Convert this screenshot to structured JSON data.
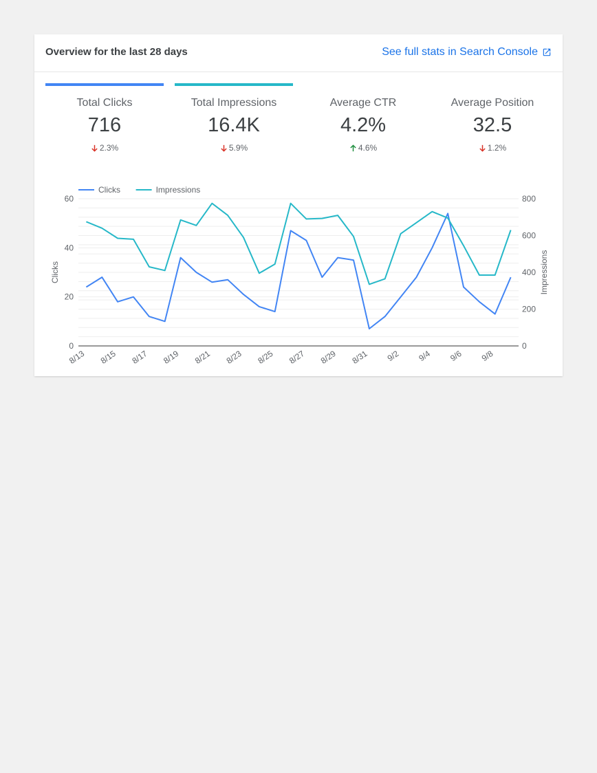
{
  "header": {
    "title": "Overview for the last 28 days",
    "link_label": "See full stats in Search Console"
  },
  "stats": [
    {
      "label": "Total Clicks",
      "value": "716",
      "change": "2.3%",
      "direction": "down",
      "bar_color": "#4285f4"
    },
    {
      "label": "Total Impressions",
      "value": "16.4K",
      "change": "5.9%",
      "direction": "down",
      "bar_color": "#26b8c8"
    },
    {
      "label": "Average CTR",
      "value": "4.2%",
      "change": "4.6%",
      "direction": "up",
      "bar_color": ""
    },
    {
      "label": "Average Position",
      "value": "32.5",
      "change": "1.2%",
      "direction": "down",
      "bar_color": ""
    }
  ],
  "colors": {
    "up": "#1e8e3e",
    "down": "#d93025",
    "link": "#1a73e8"
  },
  "chart_data": {
    "type": "line",
    "x": [
      "8/13",
      "8/14",
      "8/15",
      "8/16",
      "8/17",
      "8/18",
      "8/19",
      "8/20",
      "8/21",
      "8/22",
      "8/23",
      "8/24",
      "8/25",
      "8/26",
      "8/27",
      "8/28",
      "8/29",
      "8/30",
      "8/31",
      "9/1",
      "9/2",
      "9/3",
      "9/4",
      "9/5",
      "9/6",
      "9/7",
      "9/8",
      "9/9"
    ],
    "x_tick_labels": [
      "8/13",
      "8/15",
      "8/17",
      "8/19",
      "8/21",
      "8/23",
      "8/25",
      "8/27",
      "8/29",
      "8/31",
      "9/2",
      "9/4",
      "9/6",
      "9/8"
    ],
    "series": [
      {
        "name": "Clicks",
        "axis": "left",
        "color": "#4285f4",
        "values": [
          24,
          28,
          18,
          20,
          12,
          10,
          36,
          30,
          26,
          27,
          21,
          16,
          14,
          47,
          43,
          28,
          36,
          35,
          7,
          12,
          20,
          28,
          40,
          54,
          24,
          18,
          13,
          28
        ]
      },
      {
        "name": "Impressions",
        "axis": "right",
        "color": "#26b8c8",
        "values": [
          675,
          640,
          585,
          580,
          430,
          410,
          685,
          655,
          775,
          710,
          590,
          395,
          445,
          775,
          690,
          693,
          710,
          595,
          335,
          365,
          610,
          670,
          730,
          695,
          545,
          385,
          385,
          630
        ]
      }
    ],
    "ylabel": "Clicks",
    "ylabel_right": "Impressions",
    "ylim": [
      0,
      60
    ],
    "yticks": [
      0,
      20,
      40,
      60
    ],
    "ylim_right": [
      0,
      800
    ],
    "yticks_right": [
      0,
      200,
      400,
      600,
      800
    ],
    "grid": true,
    "legend": "top-left"
  }
}
